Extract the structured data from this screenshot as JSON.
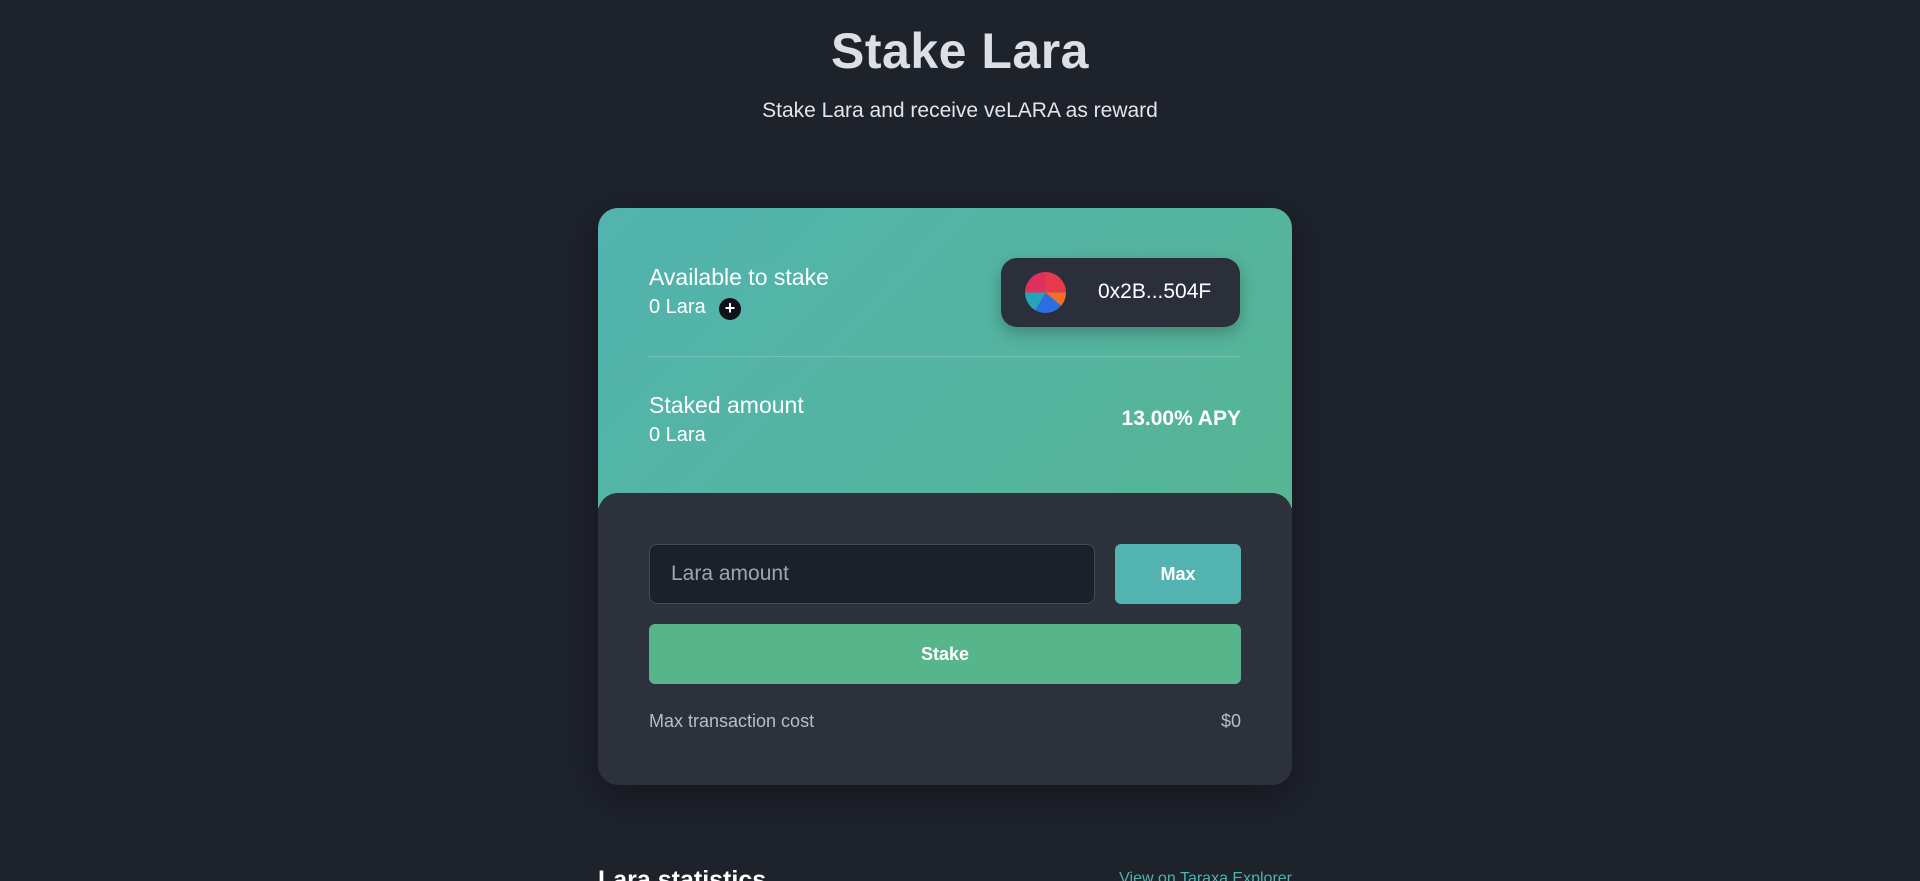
{
  "header": {
    "title": "Stake Lara",
    "subtitle": "Stake Lara and receive veLARA as reward"
  },
  "card": {
    "available": {
      "label": "Available to stake",
      "value": "0 Lara"
    },
    "wallet": {
      "address": "0x2B...504F"
    },
    "staked": {
      "label": "Staked amount",
      "value": "0 Lara"
    },
    "apy": "13.00% APY",
    "form": {
      "amount_placeholder": "Lara amount",
      "amount_value": "",
      "max_label": "Max",
      "stake_label": "Stake"
    },
    "cost": {
      "label": "Max transaction cost",
      "value": "$0"
    }
  },
  "stats": {
    "title": "Lara statistics",
    "explorer_link": "View on Taraxa Explorer"
  },
  "colors": {
    "background": "#1e222b",
    "card_gradient_start": "#52b3b0",
    "card_gradient_end": "#56b593",
    "accent_teal": "#52b3b0",
    "accent_green": "#56b58a"
  },
  "icons": {
    "add": "plus-icon",
    "wallet_avatar": "avatar"
  }
}
